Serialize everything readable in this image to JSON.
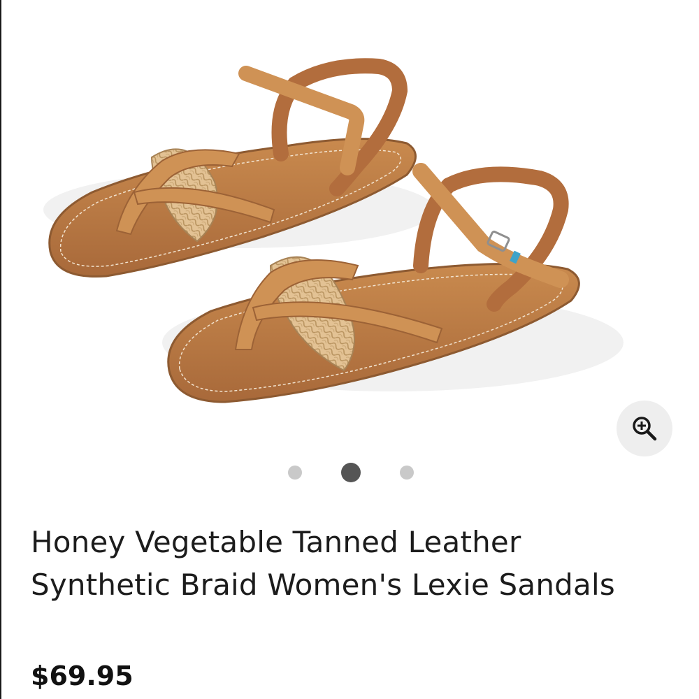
{
  "product": {
    "title": "Honey Vegetable Tanned Leather Synthetic Braid Women's Lexie Sandals",
    "price": "$69.95"
  },
  "gallery": {
    "image_alt": "Pair of tan leather braided thong sandals with ankle strap",
    "zoom_icon": "zoom-in-icon",
    "dots_total": 3,
    "active_index": 1
  },
  "colors": {
    "leather": "#c98a4e",
    "braid": "#e0bd8f",
    "zoom_bg": "#eeeeee",
    "dot_active": "#555555",
    "dot_inactive": "#c9c9c9"
  }
}
